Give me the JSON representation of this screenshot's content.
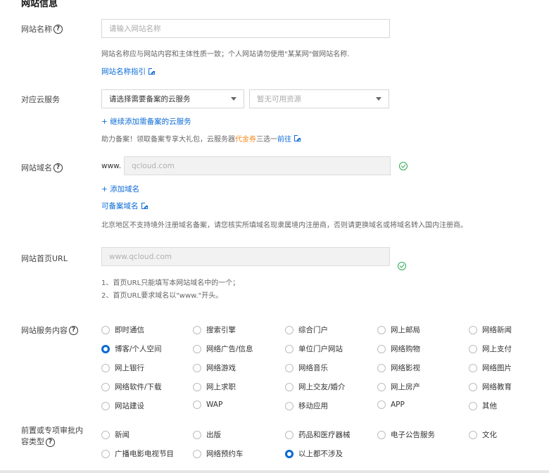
{
  "section_title": "网站信息",
  "site_name": {
    "label": "网站名称",
    "placeholder": "请输入网站名称",
    "hint": "网站名称应与网站内容和主体性质一致；个人网站请勿使用\"某某网\"做网站名称.",
    "guide_link": "网站名称指引"
  },
  "cloud_service": {
    "label": "对应云服务",
    "select_primary": "请选择需要备案的云服务",
    "select_secondary": "暂无可用资源",
    "add_link": "+ 继续添加需备案的云服务",
    "promo_prefix": "助力备案！领取备案专享大礼包，云服务器",
    "promo_highlight": "代金券",
    "promo_middle": "三选一",
    "promo_link": "前往"
  },
  "domain": {
    "label": "网站域名",
    "prefix": "www.",
    "value": "qcloud.com",
    "add_link": "+ 添加域名",
    "available_link": "可备案域名",
    "hint": "北京地区不支持境外注册域名备案，请您核实所填域名现隶属境内注册商，否则请更换域名或将域名转入国内注册商。"
  },
  "homepage": {
    "label": "网站首页URL",
    "value": "www.qcloud.com",
    "note1": "1、首页URL只能填写本网站域名中的一个；",
    "note2": "2、首页URL要求域名以\"www.\"开头。"
  },
  "service_content": {
    "label": "网站服务内容",
    "options": [
      [
        "即时通信",
        "搜索引擎",
        "综合门户",
        "网上邮局",
        "网络新闻"
      ],
      [
        "博客/个人空间",
        "网络广告/信息",
        "单位门户网站",
        "网络购物",
        "网上支付"
      ],
      [
        "网上银行",
        "网络游戏",
        "网络音乐",
        "网络影视",
        "网络图片"
      ],
      [
        "网络软件/下载",
        "网上求职",
        "网上交友/婚介",
        "网上房产",
        "网络教育"
      ],
      [
        "网站建设",
        "WAP",
        "移动应用",
        "APP",
        "其他"
      ]
    ],
    "selected": "博客/个人空间"
  },
  "approval": {
    "label_line1": "前置或专项审批内",
    "label_line2": "容类型",
    "options": [
      [
        "新闻",
        "出版",
        "药品和医疗器械",
        "电子公告服务",
        "文化"
      ],
      [
        "广播电影电视节目",
        "网络预约车",
        "以上都不涉及"
      ]
    ],
    "selected": "以上都不涉及"
  },
  "colors": {
    "link": "#0a6ad6",
    "success": "#2bab53",
    "highlight": "#f5891f"
  }
}
